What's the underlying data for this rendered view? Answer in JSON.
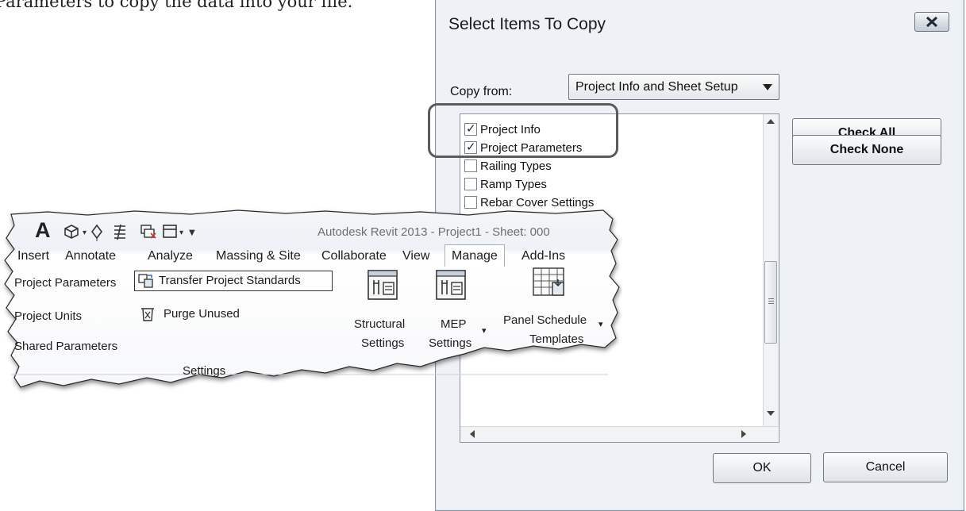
{
  "doc": {
    "intro_text": "Parameters to copy the data into your file."
  },
  "dialog": {
    "title": "Select Items To Copy",
    "copy_from_label": "Copy from:",
    "copy_from_value": "Project Info and Sheet Setup",
    "items": [
      {
        "label": "Project Info",
        "checked": true
      },
      {
        "label": "Project Parameters",
        "checked": true
      },
      {
        "label": "Railing Types",
        "checked": false
      },
      {
        "label": "Ramp Types",
        "checked": false
      },
      {
        "label": "Rebar Cover Settings",
        "checked": false
      }
    ],
    "check_all_label": "Check All",
    "check_none_label": "Check None",
    "ok_label": "OK",
    "cancel_label": "Cancel"
  },
  "ribbon": {
    "app_title": "Autodesk Revit 2013 -   Project1 - Sheet: 000",
    "qat_letter": "A",
    "tabs": [
      "Insert",
      "Annotate",
      "Analyze",
      "Massing & Site",
      "Collaborate",
      "View",
      "Manage",
      "Add-Ins"
    ],
    "active_tab": "Manage",
    "settings_items": {
      "project_parameters": "Project Parameters",
      "project_units": "Project Units",
      "shared_parameters": "Shared Parameters",
      "transfer_project_standards": "Transfer Project Standards",
      "purge_unused": "Purge Unused"
    },
    "big_buttons": {
      "structural_line1": "Structural",
      "structural_line2": "Settings",
      "mep_line1": "MEP",
      "mep_line2": "Settings",
      "panel_line1": "Panel Schedule",
      "panel_line2": "Templates"
    },
    "panel_caption": "Settings"
  },
  "colors": {
    "dialog_bg": "#eef2f7",
    "highlight_border": "#5b5b5b"
  }
}
